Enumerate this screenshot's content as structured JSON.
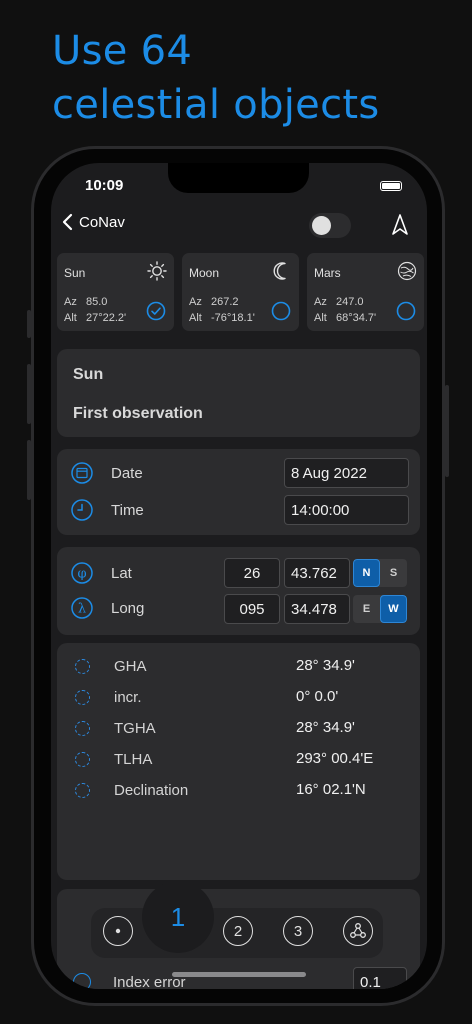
{
  "promo": {
    "line1": "Use 64",
    "line2": "celestial objects"
  },
  "status": {
    "time": "10:09"
  },
  "nav": {
    "back_label": "CoNav"
  },
  "objects": [
    {
      "name": "Sun",
      "icon": "sun-icon",
      "az_label": "Az",
      "az": "85.0",
      "alt_label": "Alt",
      "alt": "27°22.2'",
      "selected": true
    },
    {
      "name": "Moon",
      "icon": "moon-icon",
      "az_label": "Az",
      "az": "267.2",
      "alt_label": "Alt",
      "alt": "-76°18.1'",
      "selected": false
    },
    {
      "name": "Mars",
      "icon": "mars-icon",
      "az_label": "Az",
      "az": "247.0",
      "alt_label": "Alt",
      "alt": "68°34.7'",
      "selected": false
    }
  ],
  "observation": {
    "body": "Sun",
    "title": "First observation"
  },
  "datetime": {
    "date_label": "Date",
    "date_value": "8 Aug 2022",
    "time_label": "Time",
    "time_value": "14:00:00"
  },
  "position": {
    "lat_label": "Lat",
    "lat_deg": "26",
    "lat_min": "43.762",
    "lat_n": "N",
    "lat_s": "S",
    "lat_hemisphere": "N",
    "long_label": "Long",
    "long_deg": "095",
    "long_min": "34.478",
    "long_e": "E",
    "long_w": "W",
    "long_hemisphere": "W"
  },
  "computed": [
    {
      "label": "GHA",
      "value": "28° 34.9'"
    },
    {
      "label": "incr.",
      "value": "0° 0.0'"
    },
    {
      "label": "TGHA",
      "value": "28° 34.9'"
    },
    {
      "label": "TLHA",
      "value": "293° 00.4'E"
    },
    {
      "label": "Declination",
      "value": "16° 02.1'N"
    }
  ],
  "below": {
    "partial_label": "Index error",
    "partial_value": "0.1"
  },
  "tabs": {
    "active": "1",
    "t2": "2",
    "t3": "3"
  },
  "colors": {
    "accent": "#1c8ce6",
    "segment_on": "#0e5ea8",
    "card": "#2c2c2e",
    "screen": "#1c1c1e"
  }
}
